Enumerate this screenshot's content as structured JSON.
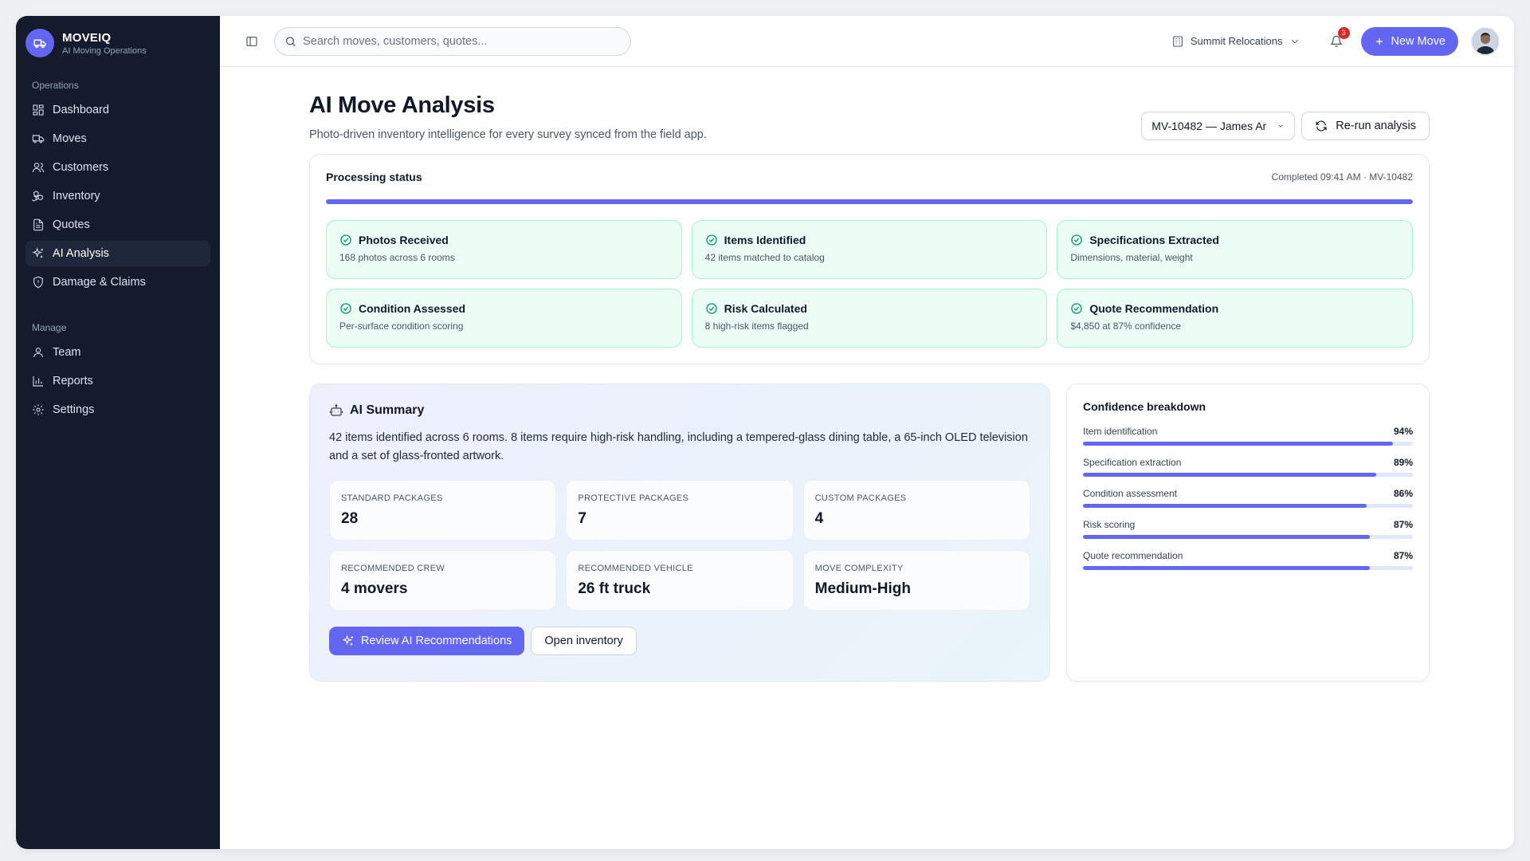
{
  "brand": {
    "name": "MOVEIQ",
    "subtitle": "AI Moving Operations"
  },
  "sidebar": {
    "sections": [
      {
        "label": "Operations",
        "items": [
          {
            "label": "Dashboard",
            "icon": "dashboard-icon"
          },
          {
            "label": "Moves",
            "icon": "truck-icon"
          },
          {
            "label": "Customers",
            "icon": "users-icon"
          },
          {
            "label": "Inventory",
            "icon": "boxes-icon"
          },
          {
            "label": "Quotes",
            "icon": "file-text-icon"
          },
          {
            "label": "AI Analysis",
            "icon": "sparkles-icon",
            "active": true
          },
          {
            "label": "Damage & Claims",
            "icon": "shield-icon"
          }
        ]
      },
      {
        "label": "Manage",
        "items": [
          {
            "label": "Team",
            "icon": "user-icon"
          },
          {
            "label": "Reports",
            "icon": "bar-chart-icon"
          },
          {
            "label": "Settings",
            "icon": "gear-icon"
          }
        ]
      }
    ]
  },
  "topbar": {
    "search_placeholder": "Search moves, customers, quotes...",
    "org_name": "Summit Relocations",
    "notification_count": "3",
    "new_move_label": "New Move"
  },
  "page": {
    "title": "AI Move Analysis",
    "subtitle": "Photo-driven inventory intelligence for every survey synced from the field app.",
    "move_select": "MV-10482 — James Ar",
    "rerun_label": "Re-run analysis"
  },
  "status": {
    "title": "Processing status",
    "meta": "Completed 09:41 AM · MV-10482",
    "progress": 1.0,
    "steps": [
      {
        "title": "Photos Received",
        "desc": "168 photos across 6 rooms"
      },
      {
        "title": "Items Identified",
        "desc": "42 items matched to catalog"
      },
      {
        "title": "Specifications Extracted",
        "desc": "Dimensions, material, weight"
      },
      {
        "title": "Condition Assessed",
        "desc": "Per-surface condition scoring"
      },
      {
        "title": "Risk Calculated",
        "desc": "8 high-risk items flagged"
      },
      {
        "title": "Quote Recommendation",
        "desc": "$4,850 at 87% confidence"
      }
    ]
  },
  "summary": {
    "title": "AI Summary",
    "text": "42 items identified across 6 rooms. 8 items require high-risk handling, including a tempered-glass dining table, a 65-inch OLED television and a set of glass-fronted artwork.",
    "metrics": [
      {
        "label": "STANDARD PACKAGES",
        "value": "28"
      },
      {
        "label": "PROTECTIVE PACKAGES",
        "value": "7"
      },
      {
        "label": "CUSTOM PACKAGES",
        "value": "4"
      },
      {
        "label": "RECOMMENDED CREW",
        "value": "4 movers"
      },
      {
        "label": "RECOMMENDED VEHICLE",
        "value": "26 ft truck"
      },
      {
        "label": "MOVE COMPLEXITY",
        "value": "Medium-High"
      }
    ],
    "review_label": "Review AI Recommendations",
    "open_inventory_label": "Open inventory"
  },
  "confidence": {
    "title": "Confidence breakdown",
    "rows": [
      {
        "label": "Item identification",
        "pct": "94%",
        "value": 94
      },
      {
        "label": "Specification extraction",
        "pct": "89%",
        "value": 89
      },
      {
        "label": "Condition assessment",
        "pct": "86%",
        "value": 86
      },
      {
        "label": "Risk scoring",
        "pct": "87%",
        "value": 87
      },
      {
        "label": "Quote recommendation",
        "pct": "87%",
        "value": 87
      }
    ]
  },
  "colors": {
    "accent": "#6366f1",
    "sidebar_bg": "#141b2d",
    "success": "#059669",
    "alert": "#dc2626"
  }
}
